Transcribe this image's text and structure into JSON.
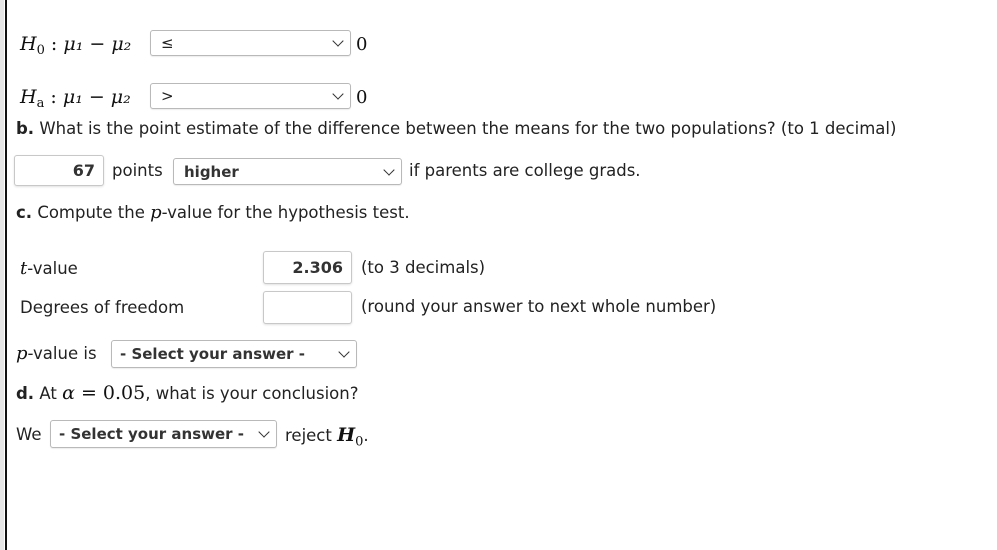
{
  "hypotheses": {
    "h0": {
      "label": "H",
      "sub": "0",
      "expr": "μ₁ − μ₂",
      "operator": "≤",
      "value": "0"
    },
    "ha": {
      "label": "H",
      "sub": "a",
      "expr": "μ₁ − μ₂",
      "operator": ">",
      "value": "0"
    }
  },
  "part_b": {
    "letter": "b.",
    "question": "What is the point estimate of the difference between the means for the two populations? (to 1 decimal)",
    "estimate_value": "67",
    "unit_label": "points",
    "direction_selected": "higher",
    "suffix": "if parents are college grads."
  },
  "part_c": {
    "letter": "c.",
    "question_pre": "Compute the ",
    "question_var": "p",
    "question_post": "-value for the hypothesis test.",
    "t_label_var": "t",
    "t_label_rest": "-value",
    "t_value": "2.306",
    "t_hint": "(to 3 decimals)",
    "df_label": "Degrees of freedom",
    "df_value": "",
    "df_hint": "(round your answer to next whole number)",
    "p_label_var": "p",
    "p_label_rest": "-value is",
    "p_selected": "- Select your answer -"
  },
  "part_d": {
    "letter": "d.",
    "pre": "At ",
    "alpha_sym": "α",
    "eq": " = ",
    "alpha_val": "0.05",
    "post": ", what is your conclusion?",
    "we_label": "We",
    "conclusion_selected": "- Select your answer -",
    "reject_text": "reject ",
    "h_label": "H",
    "h_sub": "0",
    "period": "."
  }
}
